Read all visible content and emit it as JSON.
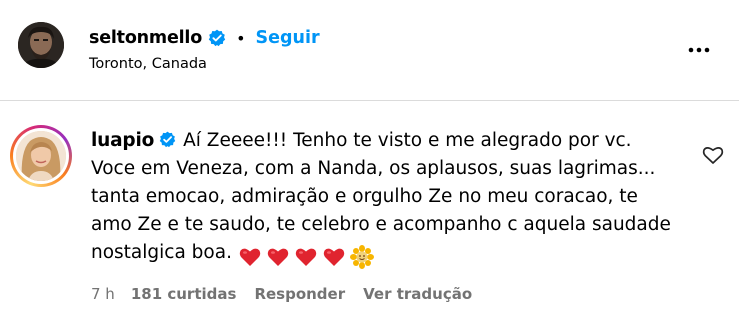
{
  "header": {
    "username": "seltonmello",
    "separator": "•",
    "follow_label": "Seguir",
    "location": "Toronto, Canada",
    "more_icon": "more-horizontal-icon",
    "verified_icon": "verified-badge-icon"
  },
  "comment": {
    "username": "luapio",
    "verified_icon": "verified-badge-icon",
    "text": "Aí Zeeee!!! Tenho te visto e me alegrado por vc. Voce em Veneza, com a Nanda, os aplausos, suas lagrimas... tanta emocao, admiração e orgulho Ze no meu coracao, te amo Ze e te saudo, te celebro e acompanho c aquela saudade nostalgica boa.",
    "emojis": [
      "red-heart-icon",
      "red-heart-icon",
      "red-heart-icon",
      "red-heart-icon",
      "sunflower-icon"
    ],
    "time": "7 h",
    "likes": "181 curtidas",
    "reply_label": "Responder",
    "translate_label": "Ver tradução",
    "like_icon": "heart-outline-icon"
  },
  "colors": {
    "link_blue": "#0095f6",
    "verified_blue": "#0095f6",
    "meta_gray": "#737373",
    "divider": "#dbdbdb",
    "heart_red": "#e0242f"
  }
}
